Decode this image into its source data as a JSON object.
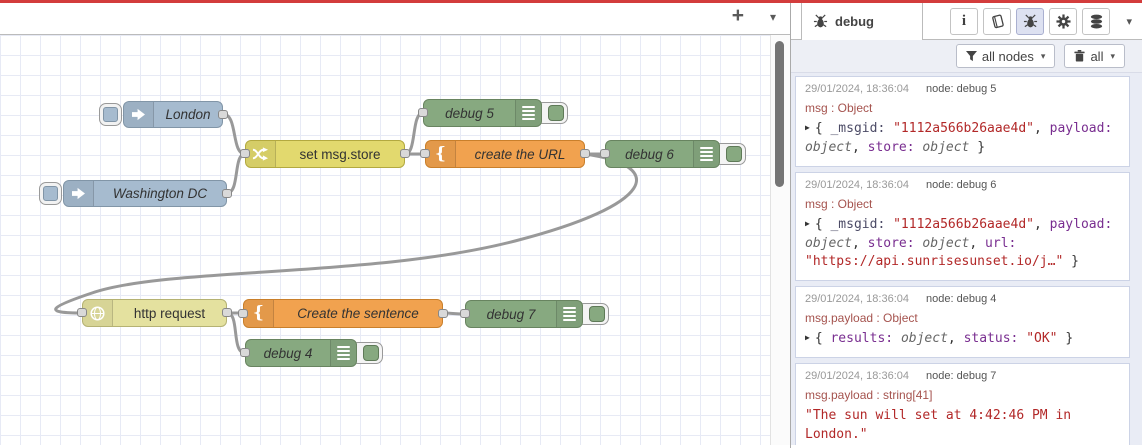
{
  "colors": {
    "accent_red": "#d33c3c",
    "wire_gray": "#999999",
    "inject_node": "#a6bbcf",
    "change_node": "#e2d96e",
    "template_node": "#f1a24f",
    "http_node": "#e4e19f",
    "debug_node": "#87a980",
    "json_key_purple": "#792e90",
    "string_red": "#b22828",
    "msg_path_red": "#a5534e"
  },
  "flow_tabbar": {
    "add_label": "+",
    "caret": "▾"
  },
  "canvas": {
    "nodes": [
      {
        "type": "inject",
        "label": "London"
      },
      {
        "type": "inject",
        "label": "Washington DC"
      },
      {
        "type": "change",
        "label": "set msg.store"
      },
      {
        "type": "debug",
        "label": "debug 5"
      },
      {
        "type": "template",
        "label": "create the URL"
      },
      {
        "type": "debug",
        "label": "debug 6"
      },
      {
        "type": "http request",
        "label": "http request"
      },
      {
        "type": "template",
        "label": "Create the sentence"
      },
      {
        "type": "debug",
        "label": "debug 7"
      },
      {
        "type": "debug",
        "label": "debug 4"
      }
    ],
    "icons": [
      "inject-arrow-icon",
      "shuffle-icon",
      "curly-brace-icon",
      "globe-icon",
      "debug-list-icon"
    ]
  },
  "sidebar": {
    "tab": {
      "label": "debug",
      "icon": "bug-icon"
    },
    "toolbar": {
      "icons": [
        "info-icon",
        "book-icon",
        "bug-icon",
        "gear-icon",
        "database-icon"
      ],
      "caret": "▾"
    },
    "filter": {
      "nodes_label": "all nodes",
      "clear_label": "all",
      "caret": "▾"
    },
    "messages": [
      {
        "ts": "29/01/2024, 18:36:04",
        "node": "node: debug 5",
        "path": "msg : Object",
        "tokens": [
          {
            "c": "caret",
            "t": "▶"
          },
          {
            "c": "plain",
            "t": "{ "
          },
          {
            "c": "keydark",
            "t": "_msgid: "
          },
          {
            "c": "str",
            "t": "\"1112a566b26aae4d\""
          },
          {
            "c": "plain",
            "t": ", "
          },
          {
            "c": "key",
            "t": "payload: "
          },
          {
            "c": "meta",
            "t": "object"
          },
          {
            "c": "plain",
            "t": ", "
          },
          {
            "c": "key",
            "t": "store: "
          },
          {
            "c": "meta",
            "t": "object"
          },
          {
            "c": "plain",
            "t": " }"
          }
        ]
      },
      {
        "ts": "29/01/2024, 18:36:04",
        "node": "node: debug 6",
        "path": "msg : Object",
        "tokens": [
          {
            "c": "caret",
            "t": "▶"
          },
          {
            "c": "plain",
            "t": "{ "
          },
          {
            "c": "keydark",
            "t": "_msgid: "
          },
          {
            "c": "str",
            "t": "\"1112a566b26aae4d\""
          },
          {
            "c": "plain",
            "t": ", "
          },
          {
            "c": "key",
            "t": "payload: "
          },
          {
            "c": "meta",
            "t": "object"
          },
          {
            "c": "plain",
            "t": ", "
          },
          {
            "c": "key",
            "t": "store: "
          },
          {
            "c": "meta",
            "t": "object"
          },
          {
            "c": "plain",
            "t": ", "
          },
          {
            "c": "key",
            "t": "url: "
          },
          {
            "c": "str",
            "t": "\"https://api.sunrisesunset.io/j…\""
          },
          {
            "c": "plain",
            "t": " }"
          }
        ]
      },
      {
        "ts": "29/01/2024, 18:36:04",
        "node": "node: debug 4",
        "path": "msg.payload : Object",
        "tokens": [
          {
            "c": "caret",
            "t": "▶"
          },
          {
            "c": "plain",
            "t": "{ "
          },
          {
            "c": "key",
            "t": "results: "
          },
          {
            "c": "meta",
            "t": "object"
          },
          {
            "c": "plain",
            "t": ", "
          },
          {
            "c": "key",
            "t": "status: "
          },
          {
            "c": "str",
            "t": "\"OK\""
          },
          {
            "c": "plain",
            "t": " }"
          }
        ]
      },
      {
        "ts": "29/01/2024, 18:36:04",
        "node": "node: debug 7",
        "path": "msg.payload : string[41]",
        "tokens": [
          {
            "c": "str",
            "t": "\"The sun will set at 4:42:46 PM in London.\""
          }
        ]
      }
    ]
  }
}
